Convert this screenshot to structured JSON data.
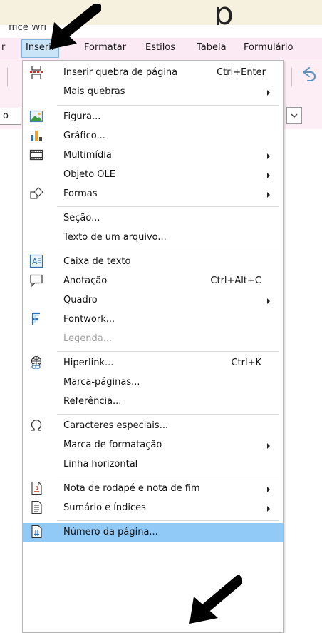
{
  "banner": {
    "glyph": "p"
  },
  "window": {
    "title_fragment": "ffice Wri"
  },
  "menubar": {
    "items": [
      {
        "label": "r"
      },
      {
        "label": "Inserir"
      },
      {
        "label": "Formatar"
      },
      {
        "label": "Estilos"
      },
      {
        "label": "Tabela"
      },
      {
        "label": "Formulário"
      }
    ]
  },
  "stylebar": {
    "style_value": "o"
  },
  "menu": {
    "items": [
      {
        "label": "Inserir quebra de página",
        "accel": "Ctrl+Enter",
        "icon": "page-break-icon"
      },
      {
        "label": "Mais quebras",
        "submenu": true
      },
      {
        "label": "Figura...",
        "icon": "image-icon"
      },
      {
        "label": "Gráfico...",
        "icon": "chart-icon"
      },
      {
        "label": "Multimídia",
        "icon": "film-icon",
        "submenu": true
      },
      {
        "label": "Objeto OLE",
        "submenu": true
      },
      {
        "label": "Formas",
        "icon": "shapes-icon",
        "submenu": true
      },
      {
        "label": "Seção..."
      },
      {
        "label": "Texto de um arquivo..."
      },
      {
        "label": "Caixa de texto",
        "icon": "text-box-icon"
      },
      {
        "label": "Anotação",
        "accel": "Ctrl+Alt+C",
        "icon": "comment-icon"
      },
      {
        "label": "Quadro",
        "submenu": true
      },
      {
        "label": "Fontwork...",
        "icon": "fontwork-icon"
      },
      {
        "label": "Legenda...",
        "disabled": true
      },
      {
        "label": "Hiperlink...",
        "accel": "Ctrl+K",
        "icon": "hyperlink-icon"
      },
      {
        "label": "Marca-páginas..."
      },
      {
        "label": "Referência..."
      },
      {
        "label": "Caracteres especiais...",
        "icon": "omega-icon"
      },
      {
        "label": "Marca de formatação",
        "submenu": true
      },
      {
        "label": "Linha horizontal"
      },
      {
        "label": "Nota de rodapé e nota de fim",
        "icon": "footnote-icon",
        "submenu": true
      },
      {
        "label": "Sumário e índices",
        "icon": "toc-icon",
        "submenu": true
      },
      {
        "label": "Número da página...",
        "icon": "page-number-icon",
        "highlighted": true
      }
    ]
  },
  "colors": {
    "banner_bg": "#f6f1de",
    "menubar_bg": "#fbe9f3",
    "toolbar_bg": "#fdeef6",
    "highlight": "#91c9f7",
    "arrow": "#000000"
  }
}
